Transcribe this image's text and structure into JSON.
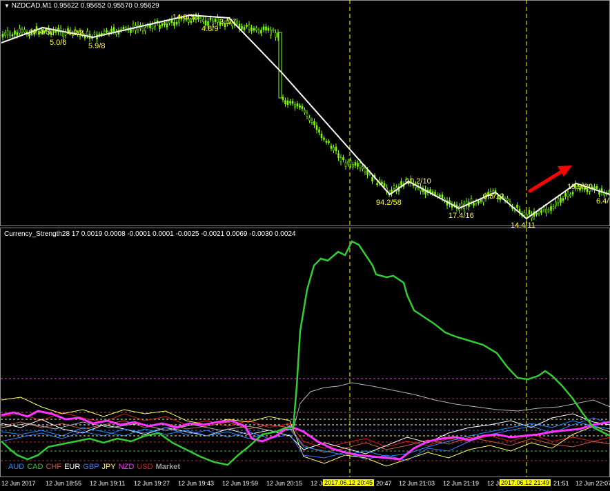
{
  "top_chart": {
    "title": "NZDCAD,M1  0.95622 0.95652 0.95570 0.95629",
    "zigzag_labels": [
      {
        "text": "17.4/30"
      },
      {
        "text": "5.0/6"
      },
      {
        "text": "4.0/8"
      },
      {
        "text": "5.9/8"
      },
      {
        "text": "14.6/32"
      },
      {
        "text": "4.8/9"
      },
      {
        "text": "3.1/7"
      },
      {
        "text": "94.2/58"
      },
      {
        "text": "10.2/10"
      },
      {
        "text": "17.4/16"
      },
      {
        "text": "9.5/12"
      },
      {
        "text": "14.4/11"
      },
      {
        "text": "19.9/30"
      },
      {
        "text": "6.4/"
      }
    ]
  },
  "bottom_chart": {
    "title": "Currency_Strength28 17 0.0019 0.0008 -0.0001 0.0001 -0.0025 -0.0021 0.0069 -0.0030 0.0024",
    "legend": [
      {
        "label": "AUD",
        "color": "#1e90ff"
      },
      {
        "label": "CAD",
        "color": "#32cd32"
      },
      {
        "label": "CHF",
        "color": "#cd5c3c"
      },
      {
        "label": "EUR",
        "color": "#ffffff"
      },
      {
        "label": "GBP",
        "color": "#3c78ff"
      },
      {
        "label": "JPY",
        "color": "#ffff66"
      },
      {
        "label": "NZD",
        "color": "#ff33ff"
      },
      {
        "label": "USD",
        "color": "#dc1e1e"
      }
    ],
    "market_label": "Market"
  },
  "time_axis": {
    "ticks": [
      {
        "label": "12 Jun 2017"
      },
      {
        "label": "12 Jun 18:55"
      },
      {
        "label": "12 Jun 19:11"
      },
      {
        "label": "12 Jun 19:27"
      },
      {
        "label": "12 Jun 19:43"
      },
      {
        "label": "12 Jun 19:59"
      },
      {
        "label": "12 Jun 20:15"
      },
      {
        "label": "12 Jun 20:"
      },
      {
        "label": "20:47"
      },
      {
        "label": "12 Jun 21:03"
      },
      {
        "label": "12 Jun 21:19"
      },
      {
        "label": "12 Jun 21:35"
      },
      {
        "label": "21:51"
      },
      {
        "label": "12 Jun 22:07"
      }
    ],
    "highlight_1": "2017.06.12 20:45",
    "highlight_2": "2017.06.12 21:49"
  },
  "colors": {
    "zigzag": "#ffffff",
    "candles": "#7cfc00",
    "vline": "#ffff00",
    "arrow": "#ff0000",
    "cad_line": "#32cd32"
  }
}
